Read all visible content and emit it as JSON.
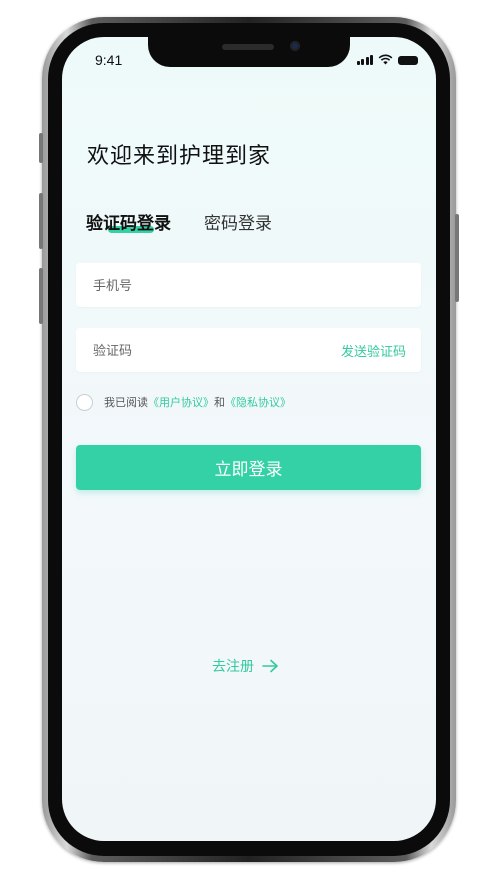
{
  "status_bar": {
    "time": "9:41"
  },
  "page": {
    "title": "欢迎来到护理到家"
  },
  "tabs": [
    {
      "label": "验证码登录",
      "active": true
    },
    {
      "label": "密码登录",
      "active": false
    }
  ],
  "phone_field": {
    "placeholder": "手机号",
    "value": ""
  },
  "code_field": {
    "placeholder": "验证码",
    "value": "",
    "send_code_label": "发送验证码"
  },
  "agreement": {
    "checked": false,
    "prefix": "我已阅读",
    "user_agreement": "《用户协议》",
    "conjunction": "和",
    "privacy_policy": "《隐私协议》"
  },
  "login_button": {
    "label": "立即登录"
  },
  "register_link": {
    "label": "去注册"
  },
  "colors": {
    "accent": "#34d1a6",
    "link": "#34c9a0",
    "title": "#111111"
  },
  "icons": [
    "signal-icon",
    "wifi-icon",
    "battery-icon",
    "arrow-right-icon"
  ]
}
